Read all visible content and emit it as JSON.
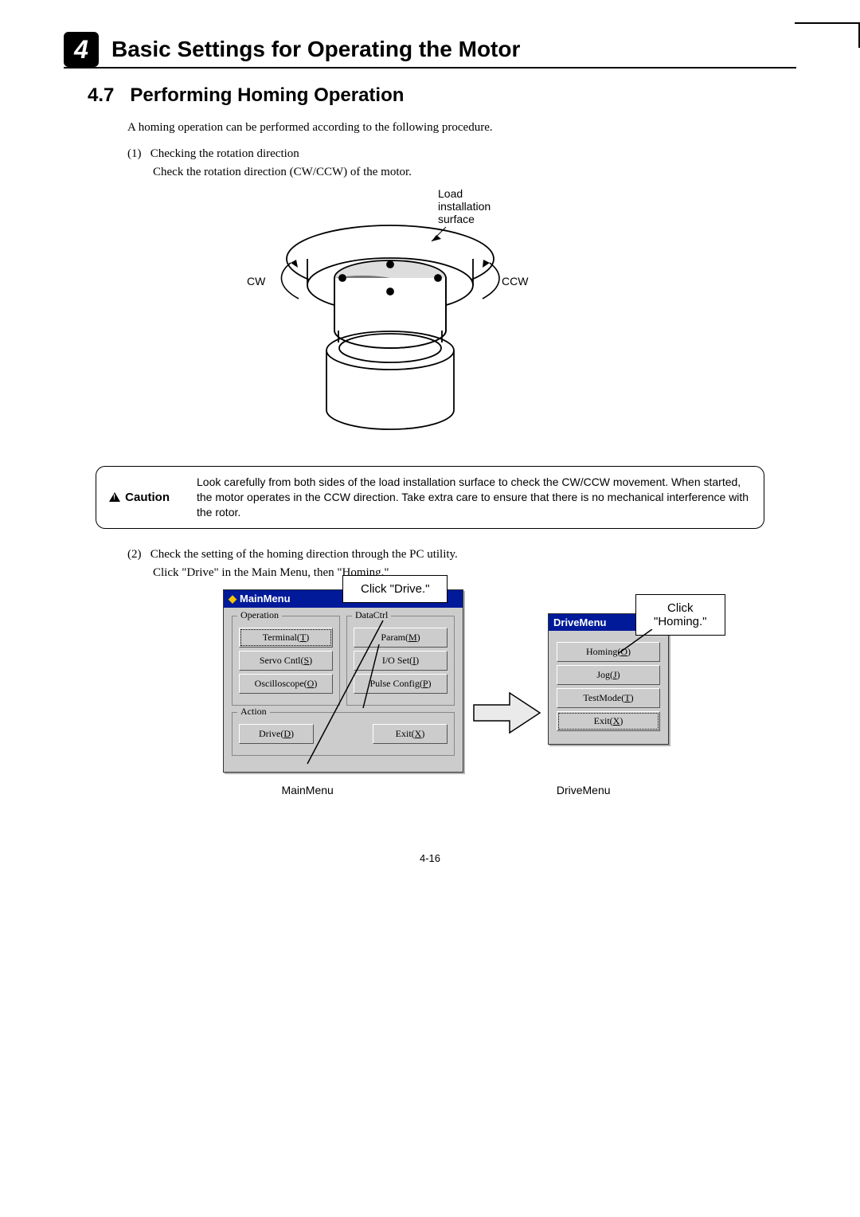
{
  "chapter": {
    "num": "4",
    "title": "Basic Settings for Operating the Motor"
  },
  "section": {
    "num": "4.7",
    "title": "Performing Homing Operation"
  },
  "intro": "A homing operation can be performed according to the following procedure.",
  "step1": {
    "num": "(1)",
    "title": "Checking the rotation direction",
    "body": "Check the rotation direction (CW/CCW) of the motor."
  },
  "motorLabels": {
    "top": "Load\ninstallation\nsurface",
    "cw": "CW",
    "ccw": "CCW"
  },
  "caution": {
    "label": "Caution",
    "text": "Look carefully from both sides of the load installation surface to check the CW/CCW movement. When started, the motor operates in the CCW direction. Take extra care to ensure that there is no mechanical interference with the rotor."
  },
  "step2": {
    "num": "(2)",
    "title": "Check the setting of the homing direction through the PC utility.",
    "body": "Click \"Drive\" in the Main Menu, then \"Homing.\""
  },
  "callouts": {
    "drive": "Click \"Drive.\"",
    "homing": "Click \"Homing.\""
  },
  "mainMenu": {
    "title": "MainMenu",
    "grpOperation": "Operation",
    "grpDataCtrl": "DataCtrl",
    "grpAction": "Action",
    "terminal": "Terminal(T)",
    "param": "Param(M)",
    "servo": "Servo Cntl(S)",
    "ioset": "I/O Set(I)",
    "osc": "Oscilloscope(O)",
    "pulse": "Pulse Config(P)",
    "drive": "Drive(D)",
    "exit": "Exit(X)"
  },
  "driveMenu": {
    "title": "DriveMenu",
    "homing": "Homing(O)",
    "jog": "Jog(J)",
    "test": "TestMode(T)",
    "exit": "Exit(X)"
  },
  "belowLabels": {
    "main": "MainMenu",
    "drive": "DriveMenu"
  },
  "pageNum": "4-16"
}
